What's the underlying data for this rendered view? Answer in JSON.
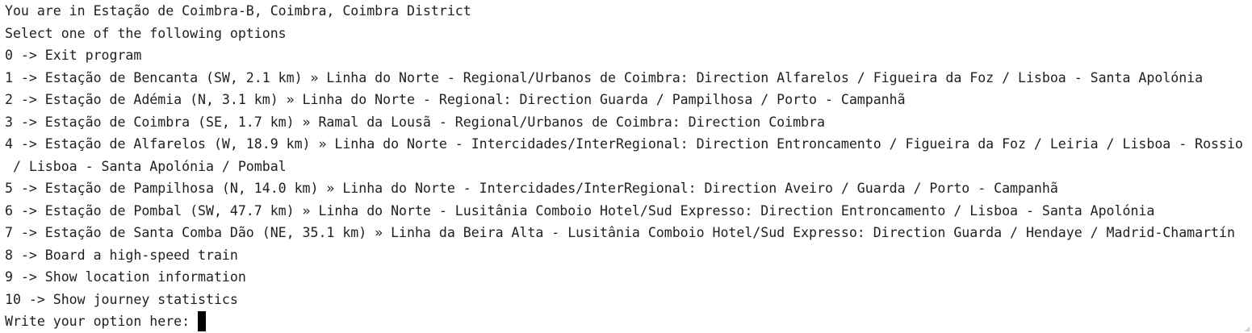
{
  "console": {
    "location_line": "You are in Estação de Coimbra-B, Coimbra, Coimbra District",
    "select_line": "Select one of the following options",
    "options": [
      "0 -> Exit program",
      "1 -> Estação de Bencanta (SW, 2.1 km) » Linha do Norte - Regional/Urbanos de Coimbra: Direction Alfarelos / Figueira da Foz / Lisboa - Santa Apolónia",
      "2 -> Estação de Adémia (N, 3.1 km) » Linha do Norte - Regional: Direction Guarda / Pampilhosa / Porto - Campanhã",
      "3 -> Estação de Coimbra (SE, 1.7 km) » Ramal da Lousã - Regional/Urbanos de Coimbra: Direction Coimbra",
      "4 -> Estação de Alfarelos (W, 18.9 km) » Linha do Norte - Intercidades/InterRegional: Direction Entroncamento / Figueira da Foz / Leiria / Lisboa - Rossio",
      " / Lisboa - Santa Apolónia / Pombal",
      "5 -> Estação de Pampilhosa (N, 14.0 km) » Linha do Norte - Intercidades/InterRegional: Direction Aveiro / Guarda / Porto - Campanhã",
      "6 -> Estação de Pombal (SW, 47.7 km) » Linha do Norte - Lusitânia Comboio Hotel/Sud Expresso: Direction Entroncamento / Lisboa - Santa Apolónia",
      "7 -> Estação de Santa Comba Dão (NE, 35.1 km) » Linha da Beira Alta - Lusitânia Comboio Hotel/Sud Expresso: Direction Guarda / Hendaye / Madrid-Chamartín",
      "8 -> Board a high-speed train",
      "9 -> Show location information",
      "10 -> Show journey statistics"
    ],
    "prompt": "Write your option here:"
  }
}
